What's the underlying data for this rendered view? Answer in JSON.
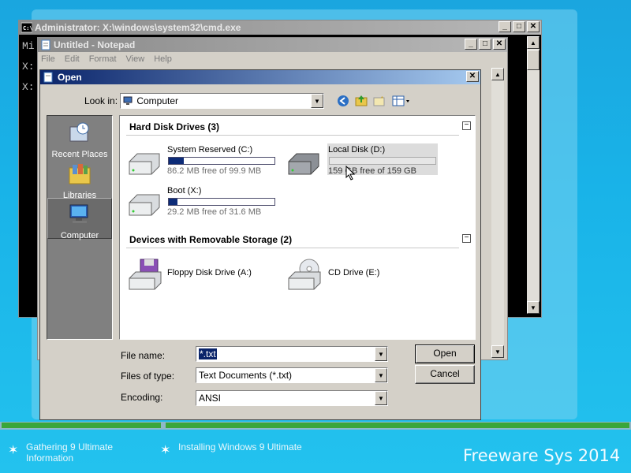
{
  "cmd": {
    "title": "Administrator: X:\\windows\\system32\\cmd.exe",
    "lines": [
      "Mi",
      "X:",
      "X:"
    ]
  },
  "notepad": {
    "title": "Untitled - Notepad",
    "menu": [
      "File",
      "Edit",
      "Format",
      "View",
      "Help"
    ]
  },
  "dialog": {
    "title": "Open",
    "look_in_label": "Look in:",
    "look_in_value": "Computer",
    "places": [
      {
        "label": "Recent Places",
        "icon": "recent-places-icon"
      },
      {
        "label": "Libraries",
        "icon": "libraries-icon"
      },
      {
        "label": "Computer",
        "icon": "computer-icon"
      }
    ],
    "sections": {
      "hdd": "Hard Disk Drives (3)",
      "removable": "Devices with Removable Storage (2)"
    },
    "drives": [
      {
        "name": "System Reserved (C:)",
        "free": "86.2 MB free of 99.9 MB",
        "used_fraction": 0.14
      },
      {
        "name": "Local Disk (D:)",
        "free": "159 GB free of 159 GB",
        "used_fraction": 0.0
      },
      {
        "name": "Boot (X:)",
        "free": "29.2 MB free of 31.6 MB",
        "used_fraction": 0.08
      }
    ],
    "removable": [
      {
        "name": "Floppy Disk Drive (A:)"
      },
      {
        "name": "CD Drive (E:)"
      }
    ],
    "file_name_label": "File name:",
    "file_name_value": "*.txt",
    "files_of_type_label": "Files of type:",
    "files_of_type_value": "Text Documents (*.txt)",
    "encoding_label": "Encoding:",
    "encoding_value": "ANSI",
    "open_button": "Open",
    "cancel_button": "Cancel"
  },
  "setup": {
    "step1": "Gathering 9 Ultimate Information",
    "step2": "Installing Windows 9 Ultimate",
    "progress1": 1.0,
    "progress2": 0.98,
    "brand": "Freeware Sys 2014"
  },
  "colors": {
    "desktop": "#1aa6df",
    "active_title": "#0a246a",
    "progress": "#3aa63a"
  }
}
